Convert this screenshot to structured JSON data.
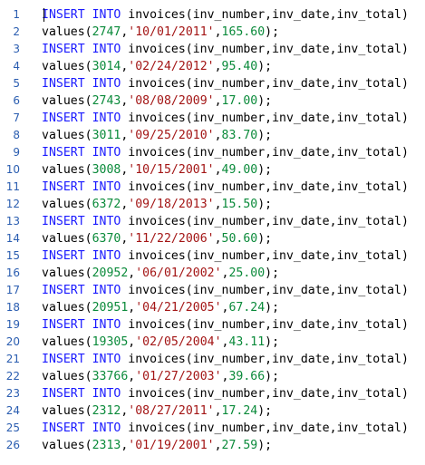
{
  "editor": {
    "colors": {
      "keyword": "#1a1aff",
      "number": "#0a8a3a",
      "string": "#a31515",
      "line_number": "#2a5db0",
      "text": "#000000"
    },
    "lines": [
      {
        "n": "1",
        "kind": "insert",
        "kw": "INSERT INTO",
        "rest": " invoices(inv_number,inv_date,inv_total)"
      },
      {
        "n": "2",
        "kind": "values",
        "fn": "values(",
        "num": "2747",
        "sep1": ",",
        "str": "'10/01/2011'",
        "sep2": ",",
        "total": "165.60",
        "end": ");"
      },
      {
        "n": "3",
        "kind": "insert",
        "kw": "INSERT INTO",
        "rest": " invoices(inv_number,inv_date,inv_total)"
      },
      {
        "n": "4",
        "kind": "values",
        "fn": "values(",
        "num": "3014",
        "sep1": ",",
        "str": "'02/24/2012'",
        "sep2": ",",
        "total": "95.40",
        "end": ");"
      },
      {
        "n": "5",
        "kind": "insert",
        "kw": "INSERT INTO",
        "rest": " invoices(inv_number,inv_date,inv_total)"
      },
      {
        "n": "6",
        "kind": "values",
        "fn": "values(",
        "num": "2743",
        "sep1": ",",
        "str": "'08/08/2009'",
        "sep2": ",",
        "total": "17.00",
        "end": ");"
      },
      {
        "n": "7",
        "kind": "insert",
        "kw": "INSERT INTO",
        "rest": " invoices(inv_number,inv_date,inv_total)"
      },
      {
        "n": "8",
        "kind": "values",
        "fn": "values(",
        "num": "3011",
        "sep1": ",",
        "str": "'09/25/2010'",
        "sep2": ",",
        "total": "83.70",
        "end": ");"
      },
      {
        "n": "9",
        "kind": "insert",
        "kw": "INSERT INTO",
        "rest": " invoices(inv_number,inv_date,inv_total)"
      },
      {
        "n": "10",
        "kind": "values",
        "fn": "values(",
        "num": "3008",
        "sep1": ",",
        "str": "'10/15/2001'",
        "sep2": ",",
        "total": "49.00",
        "end": ");"
      },
      {
        "n": "11",
        "kind": "insert",
        "kw": "INSERT INTO",
        "rest": " invoices(inv_number,inv_date,inv_total)"
      },
      {
        "n": "12",
        "kind": "values",
        "fn": "values(",
        "num": "6372",
        "sep1": ",",
        "str": "'09/18/2013'",
        "sep2": ",",
        "total": "15.50",
        "end": ");"
      },
      {
        "n": "13",
        "kind": "insert",
        "kw": "INSERT INTO",
        "rest": " invoices(inv_number,inv_date,inv_total)"
      },
      {
        "n": "14",
        "kind": "values",
        "fn": "values(",
        "num": "6370",
        "sep1": ",",
        "str": "'11/22/2006'",
        "sep2": ",",
        "total": "50.60",
        "end": ");"
      },
      {
        "n": "15",
        "kind": "insert",
        "kw": "INSERT INTO",
        "rest": " invoices(inv_number,inv_date,inv_total)"
      },
      {
        "n": "16",
        "kind": "values",
        "fn": "values(",
        "num": "20952",
        "sep1": ",",
        "str": "'06/01/2002'",
        "sep2": ",",
        "total": "25.00",
        "end": ");"
      },
      {
        "n": "17",
        "kind": "insert",
        "kw": "INSERT INTO",
        "rest": " invoices(inv_number,inv_date,inv_total)"
      },
      {
        "n": "18",
        "kind": "values",
        "fn": "values(",
        "num": "20951",
        "sep1": ",",
        "str": "'04/21/2005'",
        "sep2": ",",
        "total": "67.24",
        "end": ");"
      },
      {
        "n": "19",
        "kind": "insert",
        "kw": "INSERT INTO",
        "rest": " invoices(inv_number,inv_date,inv_total)"
      },
      {
        "n": "20",
        "kind": "values",
        "fn": "values(",
        "num": "19305",
        "sep1": ",",
        "str": "'02/05/2004'",
        "sep2": ",",
        "total": "43.11",
        "end": ");"
      },
      {
        "n": "21",
        "kind": "insert",
        "kw": "INSERT INTO",
        "rest": " invoices(inv_number,inv_date,inv_total)"
      },
      {
        "n": "22",
        "kind": "values",
        "fn": "values(",
        "num": "33766",
        "sep1": ",",
        "str": "'01/27/2003'",
        "sep2": ",",
        "total": "39.66",
        "end": ");"
      },
      {
        "n": "23",
        "kind": "insert",
        "kw": "INSERT INTO",
        "rest": " invoices(inv_number,inv_date,inv_total)"
      },
      {
        "n": "24",
        "kind": "values",
        "fn": "values(",
        "num": "2312",
        "sep1": ",",
        "str": "'08/27/2011'",
        "sep2": ",",
        "total": "17.24",
        "end": ");"
      },
      {
        "n": "25",
        "kind": "insert",
        "kw": "INSERT INTO",
        "rest": " invoices(inv_number,inv_date,inv_total)"
      },
      {
        "n": "26",
        "kind": "values",
        "fn": "values(",
        "num": "2313",
        "sep1": ",",
        "str": "'01/19/2001'",
        "sep2": ",",
        "total": "27.59",
        "end": ");"
      }
    ]
  }
}
